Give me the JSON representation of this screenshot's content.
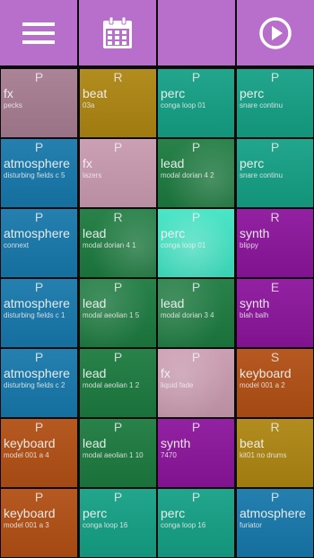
{
  "toolbar": {
    "bg": "#b86fcb",
    "buttons": [
      {
        "name": "menu-button",
        "icon": "hamburger-menu-icon"
      },
      {
        "name": "calendar-button",
        "icon": "calendar-icon"
      },
      {
        "name": "blank-button",
        "icon": ""
      },
      {
        "name": "play-button",
        "icon": "play-circle-icon"
      }
    ]
  },
  "colors": {
    "mauve": "#a67c91",
    "gold": "#ad8511",
    "teal": "#14a085",
    "blue": "#1778ab",
    "pink": "#c99aaf",
    "green": "#1c7a3f",
    "aqua": "#3fe3c3",
    "purple": "#8b149b",
    "orange": "#b14f14"
  },
  "pads": [
    [
      {
        "mode": "P",
        "category": "fx",
        "name": "pecks",
        "color": "#a67c91"
      },
      {
        "mode": "R",
        "category": "beat",
        "name": "03a",
        "color": "#ad8511"
      },
      {
        "mode": "P",
        "category": "perc",
        "name": "conga loop 01",
        "color": "#14a085"
      },
      {
        "mode": "P",
        "category": "perc",
        "name": "snare continu",
        "color": "#14a085"
      }
    ],
    [
      {
        "mode": "P",
        "category": "atmosphere",
        "name": "disturbing fields c 5",
        "color": "#1778ab"
      },
      {
        "mode": "P",
        "category": "fx",
        "name": "lazers",
        "color": "#c99aaf"
      },
      {
        "mode": "P",
        "category": "lead",
        "name": "modal dorian 4 2",
        "color": "#1c7a3f"
      },
      {
        "mode": "P",
        "category": "perc",
        "name": "snare continu",
        "color": "#14a085"
      }
    ],
    [
      {
        "mode": "P",
        "category": "atmosphere",
        "name": "connext",
        "color": "#1778ab"
      },
      {
        "mode": "R",
        "category": "lead",
        "name": "modal dorian 4 1",
        "color": "#1c7a3f"
      },
      {
        "mode": "P",
        "category": "perc",
        "name": "conga loop 01",
        "color": "#3fe3c3"
      },
      {
        "mode": "R",
        "category": "synth",
        "name": "blippy",
        "color": "#8b149b"
      }
    ],
    [
      {
        "mode": "P",
        "category": "atmosphere",
        "name": "disturbing fields c 1",
        "color": "#1778ab"
      },
      {
        "mode": "P",
        "category": "lead",
        "name": "modal aeolian 1 5",
        "color": "#1c7a3f"
      },
      {
        "mode": "P",
        "category": "lead",
        "name": "modal dorian 3 4",
        "color": "#1c7a3f"
      },
      {
        "mode": "E",
        "category": "synth",
        "name": "blah balh",
        "color": "#8b149b"
      }
    ],
    [
      {
        "mode": "P",
        "category": "atmosphere",
        "name": "disturbing fields c 2",
        "color": "#1778ab"
      },
      {
        "mode": "P",
        "category": "lead",
        "name": "modal aeolian 1 2",
        "color": "#1c7a3f"
      },
      {
        "mode": "P",
        "category": "fx",
        "name": "liquid fade",
        "color": "#c99aaf"
      },
      {
        "mode": "S",
        "category": "keyboard",
        "name": "model 001 a 2",
        "color": "#b14f14"
      }
    ],
    [
      {
        "mode": "P",
        "category": "keyboard",
        "name": "model 001 a 4",
        "color": "#b14f14"
      },
      {
        "mode": "P",
        "category": "lead",
        "name": "modal aeolian 1 10",
        "color": "#1c7a3f"
      },
      {
        "mode": "P",
        "category": "synth",
        "name": "7470",
        "color": "#8b149b"
      },
      {
        "mode": "R",
        "category": "beat",
        "name": "kit01 no drums",
        "color": "#ad8511"
      }
    ],
    [
      {
        "mode": "P",
        "category": "keyboard",
        "name": "model 001 a 3",
        "color": "#b14f14"
      },
      {
        "mode": "P",
        "category": "perc",
        "name": "conga loop 16",
        "color": "#14a085"
      },
      {
        "mode": "P",
        "category": "perc",
        "name": "conga loop 16",
        "color": "#14a085"
      },
      {
        "mode": "P",
        "category": "atmosphere",
        "name": "furiator",
        "color": "#1778ab"
      }
    ]
  ]
}
